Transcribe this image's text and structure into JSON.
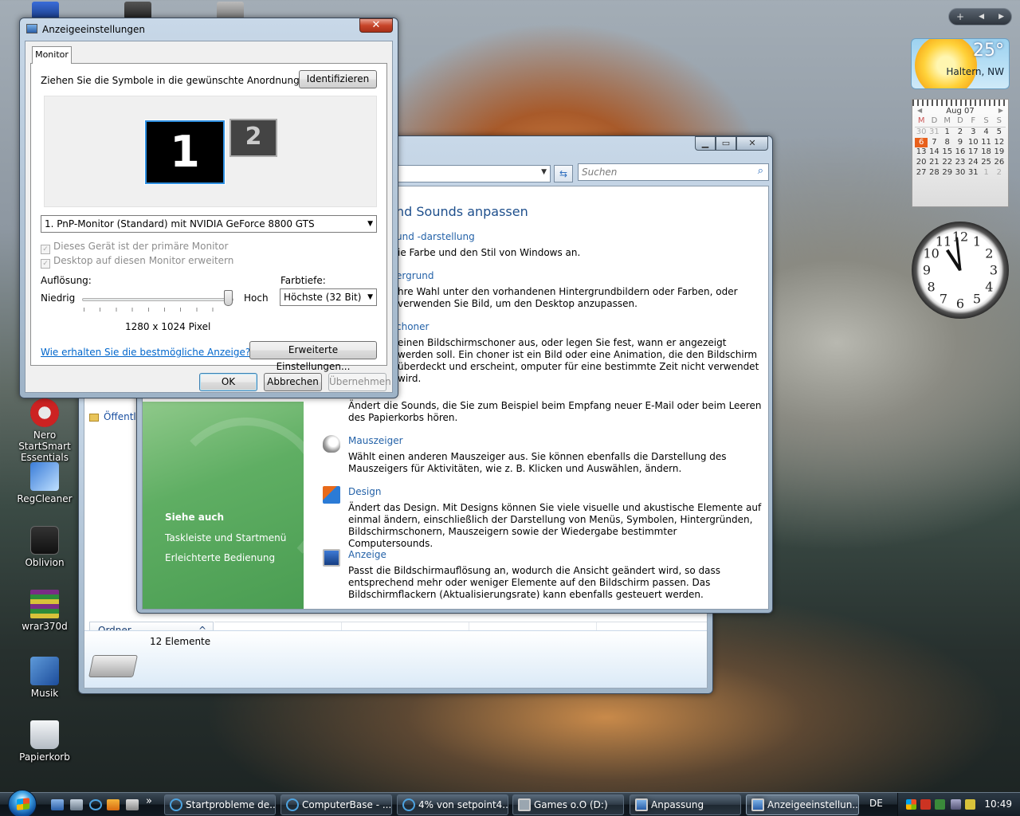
{
  "desktop": {
    "icons": [
      {
        "name": "nero-startsmart-icon",
        "label": "Nero StartSmart Essentials"
      },
      {
        "name": "regcleaner-icon",
        "label": "RegCleaner"
      },
      {
        "name": "oblivion-icon",
        "label": "Oblivion"
      },
      {
        "name": "wrar-icon",
        "label": "wrar370d"
      },
      {
        "name": "musik-icon",
        "label": "Musik"
      },
      {
        "name": "papierkorb-icon",
        "label": "Papierkorb"
      }
    ]
  },
  "gadgets": {
    "weather": {
      "temperature": "25°",
      "location": "Haltern, NW"
    },
    "calendar": {
      "month": "Aug 07",
      "prev": "◀",
      "next": "▶",
      "weekdays": [
        "M",
        "D",
        "M",
        "D",
        "F",
        "S",
        "S"
      ],
      "days": [
        "30",
        "31",
        "1",
        "2",
        "3",
        "4",
        "5",
        "6",
        "7",
        "8",
        "9",
        "10",
        "11",
        "12",
        "13",
        "14",
        "15",
        "16",
        "17",
        "18",
        "19",
        "20",
        "21",
        "22",
        "23",
        "24",
        "25",
        "26",
        "27",
        "28",
        "29",
        "30",
        "31",
        "1",
        "2"
      ],
      "today": "6"
    },
    "clock": {
      "numerals": [
        "12",
        "1",
        "2",
        "3",
        "4",
        "5",
        "6",
        "7",
        "8",
        "9",
        "10",
        "11"
      ]
    },
    "sidebar_controls": {
      "add": "+",
      "prev": "◀",
      "next": "▶"
    }
  },
  "explorer": {
    "folder_item": "Öffentl",
    "folders_pane_label": "Ordner",
    "folders_chevron": "^",
    "item_count": "12 Elemente"
  },
  "personalization": {
    "search_placeholder": "Suchen",
    "search_icon": "search-icon",
    "refresh_glyph": "⇆",
    "caption": {
      "minimize": "▁",
      "maximize": "▭",
      "close": "✕"
    },
    "heading": "nd Sounds anpassen",
    "items": [
      {
        "link": " und -darstellung",
        "desc": "ie Farbe und den Stil von Windows an."
      },
      {
        "link": "ergrund",
        "desc": "hre Wahl unter den vorhandenen Hintergrundbildern oder Farben, oder verwenden Sie Bild, um den Desktop anzupassen."
      },
      {
        "link": "choner",
        "desc": "einen Bildschirmschoner aus, oder legen Sie fest, wann er angezeigt werden soll. Ein choner ist ein Bild oder eine Animation, die den Bildschirm überdeckt und erscheint, omputer für eine bestimmte Zeit nicht verwendet wird."
      },
      {
        "link": "",
        "desc": "Ändert die Sounds, die Sie zum Beispiel beim Empfang neuer E-Mail oder beim Leeren des Papierkorbs hören."
      },
      {
        "link": "Mauszeiger",
        "desc": "Wählt einen anderen Mauszeiger aus. Sie können ebenfalls die Darstellung des Mauszeigers für Aktivitäten, wie z. B. Klicken und Auswählen, ändern."
      },
      {
        "link": "Design",
        "desc": "Ändert das Design. Mit Designs können Sie viele visuelle und akustische Elemente auf einmal ändern, einschließlich der Darstellung von Menüs, Symbolen, Hintergründen, Bildschirmschonern, Mauszeigern sowie der Wiedergabe bestimmter Computersounds."
      },
      {
        "link": "Anzeige",
        "desc": "Passt die Bildschirmauflösung an, wodurch die Ansicht geändert wird, so dass entsprechend mehr oder weniger Elemente auf den Bildschirm passen. Das Bildschirmflackern (Aktualisierungsrate) kann ebenfalls gesteuert werden."
      }
    ],
    "see_also": {
      "title": "Siehe auch",
      "links": [
        "Taskleiste und Startmenü",
        "Erleichterte Bedienung"
      ]
    }
  },
  "dialog": {
    "title": "Anzeigeeinstellungen",
    "close": "✕",
    "tab": "Monitor",
    "instruction": "Ziehen Sie die Symbole in die gewünschte Anordnung.",
    "identify_button": "Identifizieren",
    "monitor1": "1",
    "monitor2": "2",
    "monitor_select": "1. PnP-Monitor (Standard) mit NVIDIA GeForce 8800 GTS",
    "dropdown_arrow": "▼",
    "checkbox_primary": "Dieses Gerät ist der primäre Monitor",
    "checkbox_extend": "Desktop auf diesen Monitor erweitern",
    "check_mark": "✓",
    "resolution_label": "Auflösung:",
    "low_label": "Niedrig",
    "high_label": "Hoch",
    "resolution_value": "1280 x 1024 Pixel",
    "resolution_level": 1.0,
    "color_depth_label": "Farbtiefe:",
    "color_depth_value": "Höchste (32 Bit)",
    "help_link": "Wie erhalten Sie die bestmögliche Anzeige?",
    "advanced_button": "Erweiterte Einstellungen...",
    "ok_button": "OK",
    "cancel_button": "Abbrechen",
    "apply_button": "Übernehmen"
  },
  "taskbar": {
    "quicklaunch_more": "»",
    "tasks": [
      {
        "label": "Startprobleme de...",
        "icon": "ie"
      },
      {
        "label": "ComputerBase - ...",
        "icon": "ie"
      },
      {
        "label": "4% von setpoint4...",
        "icon": "ie"
      },
      {
        "label": "Games o.O (D:)",
        "icon": "drive"
      },
      {
        "label": "Anpassung",
        "icon": "window"
      },
      {
        "label": "Anzeigeeinstellun...",
        "icon": "window"
      }
    ],
    "language": "DE",
    "time": "10:49"
  },
  "colors": {
    "accent": "#2462a8",
    "link": "#0066cc",
    "sidebar_green": "#5fae63",
    "close_red": "#c8452a",
    "monitor_selected": "#2f8fe0",
    "calendar_today": "#e8601c"
  }
}
